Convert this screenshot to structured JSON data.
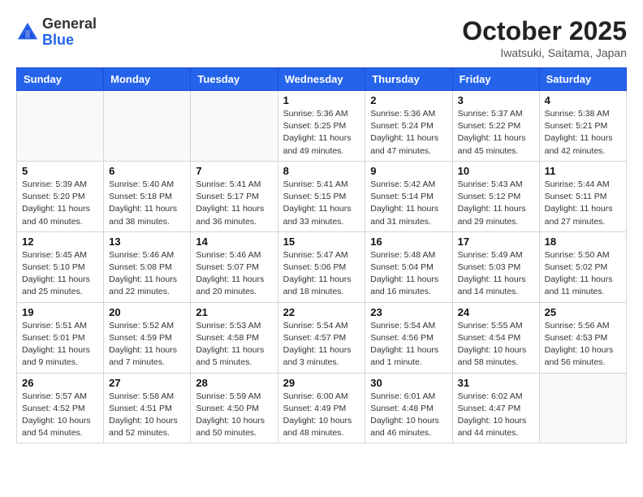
{
  "header": {
    "logo_general": "General",
    "logo_blue": "Blue",
    "month_title": "October 2025",
    "location": "Iwatsuki, Saitama, Japan"
  },
  "weekdays": [
    "Sunday",
    "Monday",
    "Tuesday",
    "Wednesday",
    "Thursday",
    "Friday",
    "Saturday"
  ],
  "weeks": [
    [
      {
        "day": "",
        "info": ""
      },
      {
        "day": "",
        "info": ""
      },
      {
        "day": "",
        "info": ""
      },
      {
        "day": "1",
        "info": "Sunrise: 5:36 AM\nSunset: 5:25 PM\nDaylight: 11 hours\nand 49 minutes."
      },
      {
        "day": "2",
        "info": "Sunrise: 5:36 AM\nSunset: 5:24 PM\nDaylight: 11 hours\nand 47 minutes."
      },
      {
        "day": "3",
        "info": "Sunrise: 5:37 AM\nSunset: 5:22 PM\nDaylight: 11 hours\nand 45 minutes."
      },
      {
        "day": "4",
        "info": "Sunrise: 5:38 AM\nSunset: 5:21 PM\nDaylight: 11 hours\nand 42 minutes."
      }
    ],
    [
      {
        "day": "5",
        "info": "Sunrise: 5:39 AM\nSunset: 5:20 PM\nDaylight: 11 hours\nand 40 minutes."
      },
      {
        "day": "6",
        "info": "Sunrise: 5:40 AM\nSunset: 5:18 PM\nDaylight: 11 hours\nand 38 minutes."
      },
      {
        "day": "7",
        "info": "Sunrise: 5:41 AM\nSunset: 5:17 PM\nDaylight: 11 hours\nand 36 minutes."
      },
      {
        "day": "8",
        "info": "Sunrise: 5:41 AM\nSunset: 5:15 PM\nDaylight: 11 hours\nand 33 minutes."
      },
      {
        "day": "9",
        "info": "Sunrise: 5:42 AM\nSunset: 5:14 PM\nDaylight: 11 hours\nand 31 minutes."
      },
      {
        "day": "10",
        "info": "Sunrise: 5:43 AM\nSunset: 5:12 PM\nDaylight: 11 hours\nand 29 minutes."
      },
      {
        "day": "11",
        "info": "Sunrise: 5:44 AM\nSunset: 5:11 PM\nDaylight: 11 hours\nand 27 minutes."
      }
    ],
    [
      {
        "day": "12",
        "info": "Sunrise: 5:45 AM\nSunset: 5:10 PM\nDaylight: 11 hours\nand 25 minutes."
      },
      {
        "day": "13",
        "info": "Sunrise: 5:46 AM\nSunset: 5:08 PM\nDaylight: 11 hours\nand 22 minutes."
      },
      {
        "day": "14",
        "info": "Sunrise: 5:46 AM\nSunset: 5:07 PM\nDaylight: 11 hours\nand 20 minutes."
      },
      {
        "day": "15",
        "info": "Sunrise: 5:47 AM\nSunset: 5:06 PM\nDaylight: 11 hours\nand 18 minutes."
      },
      {
        "day": "16",
        "info": "Sunrise: 5:48 AM\nSunset: 5:04 PM\nDaylight: 11 hours\nand 16 minutes."
      },
      {
        "day": "17",
        "info": "Sunrise: 5:49 AM\nSunset: 5:03 PM\nDaylight: 11 hours\nand 14 minutes."
      },
      {
        "day": "18",
        "info": "Sunrise: 5:50 AM\nSunset: 5:02 PM\nDaylight: 11 hours\nand 11 minutes."
      }
    ],
    [
      {
        "day": "19",
        "info": "Sunrise: 5:51 AM\nSunset: 5:01 PM\nDaylight: 11 hours\nand 9 minutes."
      },
      {
        "day": "20",
        "info": "Sunrise: 5:52 AM\nSunset: 4:59 PM\nDaylight: 11 hours\nand 7 minutes."
      },
      {
        "day": "21",
        "info": "Sunrise: 5:53 AM\nSunset: 4:58 PM\nDaylight: 11 hours\nand 5 minutes."
      },
      {
        "day": "22",
        "info": "Sunrise: 5:54 AM\nSunset: 4:57 PM\nDaylight: 11 hours\nand 3 minutes."
      },
      {
        "day": "23",
        "info": "Sunrise: 5:54 AM\nSunset: 4:56 PM\nDaylight: 11 hours\nand 1 minute."
      },
      {
        "day": "24",
        "info": "Sunrise: 5:55 AM\nSunset: 4:54 PM\nDaylight: 10 hours\nand 58 minutes."
      },
      {
        "day": "25",
        "info": "Sunrise: 5:56 AM\nSunset: 4:53 PM\nDaylight: 10 hours\nand 56 minutes."
      }
    ],
    [
      {
        "day": "26",
        "info": "Sunrise: 5:57 AM\nSunset: 4:52 PM\nDaylight: 10 hours\nand 54 minutes."
      },
      {
        "day": "27",
        "info": "Sunrise: 5:58 AM\nSunset: 4:51 PM\nDaylight: 10 hours\nand 52 minutes."
      },
      {
        "day": "28",
        "info": "Sunrise: 5:59 AM\nSunset: 4:50 PM\nDaylight: 10 hours\nand 50 minutes."
      },
      {
        "day": "29",
        "info": "Sunrise: 6:00 AM\nSunset: 4:49 PM\nDaylight: 10 hours\nand 48 minutes."
      },
      {
        "day": "30",
        "info": "Sunrise: 6:01 AM\nSunset: 4:48 PM\nDaylight: 10 hours\nand 46 minutes."
      },
      {
        "day": "31",
        "info": "Sunrise: 6:02 AM\nSunset: 4:47 PM\nDaylight: 10 hours\nand 44 minutes."
      },
      {
        "day": "",
        "info": ""
      }
    ]
  ]
}
